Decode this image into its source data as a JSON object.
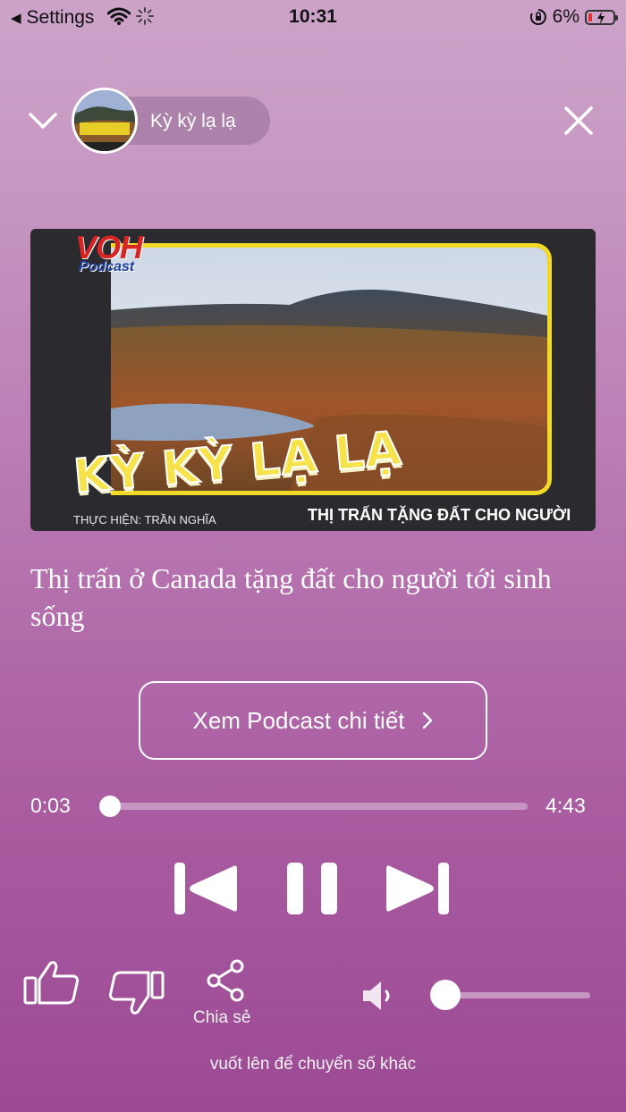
{
  "status_bar": {
    "back_label": "Settings",
    "time": "10:31",
    "battery_percent": "6%",
    "battery_level": 0.06
  },
  "header": {
    "podcast_name": "Kỳ kỳ lạ lạ"
  },
  "artwork": {
    "brand_main": "VOH",
    "brand_sub": "Podcast",
    "title": "KỲ KỲ LẠ LẠ",
    "credit": "THỰC HIỆN: TRẦN NGHĨA",
    "subtitle": "THỊ TRẤN TẶNG ĐẤT CHO NGƯỜI"
  },
  "episode": {
    "title": "Thị trấn ở Canada tặng đất cho người tới sinh sống"
  },
  "details_button": {
    "label": "Xem Podcast chi tiết"
  },
  "player": {
    "current_time": "0:03",
    "duration": "4:43",
    "progress_fraction": 0.01,
    "volume_fraction": 0.0
  },
  "actions": {
    "share_label": "Chia sẻ"
  },
  "footer": {
    "hint": "vuốt lên để chuyển số khác"
  },
  "icons": [
    "back-triangle-icon",
    "wifi-icon",
    "spinner-icon",
    "orientation-lock-icon",
    "battery-icon",
    "chevron-down-icon",
    "close-icon",
    "previous-icon",
    "pause-icon",
    "next-icon",
    "thumbs-up-icon",
    "thumbs-down-icon",
    "share-icon",
    "speaker-icon",
    "chevron-right-icon"
  ]
}
